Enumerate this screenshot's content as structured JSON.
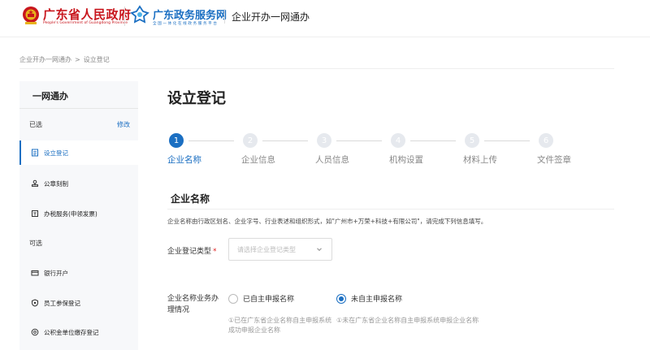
{
  "header": {
    "gov_name": "广东省人民政府",
    "gov_sub": "People's Government of Guangdong Province",
    "service_name": "广东政务服务网",
    "service_sub": "全国一体化在线政务服务平台",
    "page_name": "企业开办一网通办"
  },
  "breadcrumb": {
    "items": [
      "企业开办一网通办",
      "设立登记"
    ],
    "separator": ">"
  },
  "sidebar": {
    "title": "一网通办",
    "selected_header": "已选",
    "modify_label": "修改",
    "selected_items": [
      {
        "label": "设立登记",
        "icon": "document-icon",
        "active": true
      },
      {
        "label": "公章刻制",
        "icon": "stamp-icon",
        "active": false
      },
      {
        "label": "办税服务(申领发票)",
        "icon": "tax-icon",
        "active": false
      }
    ],
    "optional_header": "可选",
    "optional_items": [
      {
        "label": "银行开户",
        "icon": "bank-card-icon"
      },
      {
        "label": "员工参保登记",
        "icon": "insurance-icon"
      },
      {
        "label": "公积金单位缴存登记",
        "icon": "fund-icon"
      }
    ]
  },
  "main": {
    "page_title": "设立登记",
    "steps": [
      {
        "number": "1",
        "label": "企业名称",
        "active": true
      },
      {
        "number": "2",
        "label": "企业信息",
        "active": false
      },
      {
        "number": "3",
        "label": "人员信息",
        "active": false
      },
      {
        "number": "4",
        "label": "机构设置",
        "active": false
      },
      {
        "number": "5",
        "label": "材料上传",
        "active": false
      },
      {
        "number": "6",
        "label": "文件签章",
        "active": false
      }
    ],
    "section_title": "企业名称",
    "hint": "企业名称由行政区划名、企业字号、行业表述和组织形式，如\"广州市+万荣+科技+有限公司\"，请完成下列信息填写。",
    "registration_type": {
      "label": "企业登记类型",
      "required_mark": "*",
      "placeholder": "请选择企业登记类型"
    },
    "name_handling": {
      "label": "企业名称业务办理情况",
      "options": [
        {
          "label": "已自主申报名称",
          "checked": false,
          "note": "①已在广东省企业名称自主申报系统成功申报企业名称"
        },
        {
          "label": "未自主申报名称",
          "checked": true,
          "note": "①未在广东省企业名称自主申报系统申报企业名称"
        }
      ]
    }
  },
  "colors": {
    "brand_red": "#c8161d",
    "brand_blue": "#1b6fc2",
    "required_red": "#e02020"
  }
}
